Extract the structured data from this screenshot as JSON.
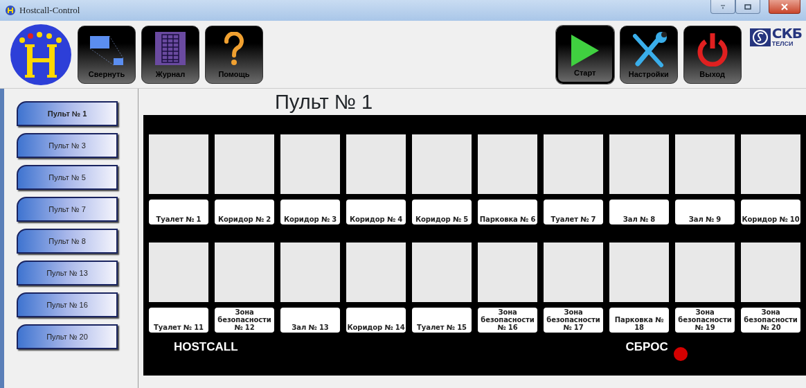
{
  "window": {
    "title": "Hostcall-Control"
  },
  "toolbar_left": [
    {
      "kind": "collapse",
      "label": "Свернуть",
      "selected": false
    },
    {
      "kind": "log",
      "label": "Журнал",
      "selected": false
    },
    {
      "kind": "help",
      "label": "Помощь",
      "selected": false
    }
  ],
  "toolbar_right": [
    {
      "kind": "start",
      "label": "Старт",
      "selected": true
    },
    {
      "kind": "settings",
      "label": "Настройки",
      "selected": false
    },
    {
      "kind": "exit",
      "label": "Выход",
      "selected": false
    }
  ],
  "brand": {
    "name": "СКБ",
    "subtitle": "ТЕЛСИ"
  },
  "sidebar": {
    "items": [
      {
        "label": "Пульт № 1",
        "selected": true
      },
      {
        "label": "Пульт № 3",
        "selected": false
      },
      {
        "label": "Пульт № 5",
        "selected": false
      },
      {
        "label": "Пульт № 7",
        "selected": false
      },
      {
        "label": "Пульт № 8",
        "selected": false
      },
      {
        "label": "Пульт № 13",
        "selected": false
      },
      {
        "label": "Пульт № 16",
        "selected": false
      },
      {
        "label": "Пульт № 20",
        "selected": false
      }
    ]
  },
  "panel": {
    "heading": "Пульт № 1",
    "rows": [
      [
        "Туалет № 1",
        "Коридор № 2",
        "Коридор № 3",
        "Коридор № 4",
        "Коридор № 5",
        "Парковка № 6",
        "Туалет № 7",
        "Зал № 8",
        "Зал № 9",
        "Коридор № 10"
      ],
      [
        "Туалет № 11",
        "Зона безопасности № 12",
        "Зал № 13",
        "Коридор № 14",
        "Туалет № 15",
        "Зона безопасности № 16",
        "Зона безопасности № 17",
        "Парковка № 18",
        "Зона безопасности № 19",
        "Зона безопасности № 20"
      ]
    ],
    "brand_label": "HOSTCALL",
    "reset_label": "СБРОС",
    "reset_indicator": {
      "color": "#d40000"
    }
  }
}
